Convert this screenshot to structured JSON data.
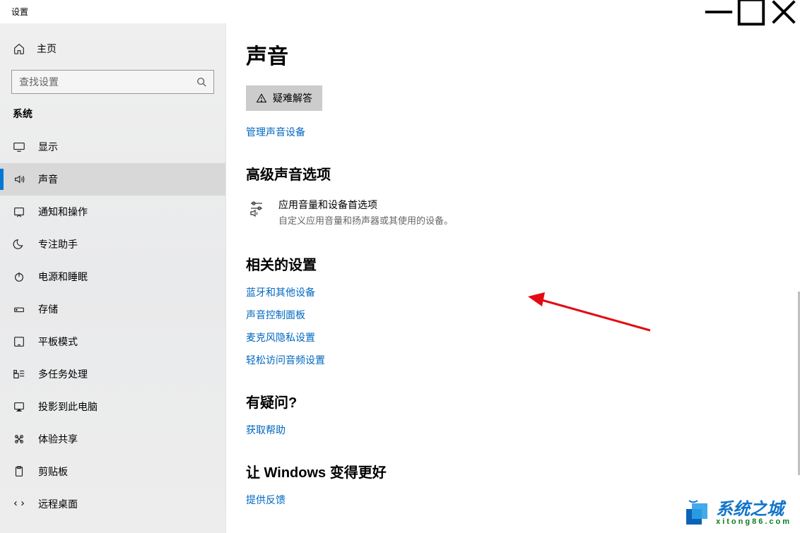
{
  "window": {
    "title": "设置"
  },
  "controls": {
    "min": "–",
    "max": "☐",
    "close": "✕"
  },
  "sidebar": {
    "home": "主页",
    "search_placeholder": "查找设置",
    "category": "系统",
    "items": [
      {
        "label": "显示",
        "icon": "display"
      },
      {
        "label": "声音",
        "icon": "sound",
        "active": true
      },
      {
        "label": "通知和操作",
        "icon": "notify"
      },
      {
        "label": "专注助手",
        "icon": "moon"
      },
      {
        "label": "电源和睡眠",
        "icon": "power"
      },
      {
        "label": "存储",
        "icon": "storage"
      },
      {
        "label": "平板模式",
        "icon": "tablet"
      },
      {
        "label": "多任务处理",
        "icon": "multitask"
      },
      {
        "label": "投影到此电脑",
        "icon": "project"
      },
      {
        "label": "体验共享",
        "icon": "share"
      },
      {
        "label": "剪贴板",
        "icon": "clipboard"
      },
      {
        "label": "远程桌面",
        "icon": "remote"
      }
    ]
  },
  "page": {
    "title": "声音",
    "troubleshoot": "疑难解答",
    "manage_link": "管理声音设备",
    "advanced_head": "高级声音选项",
    "adv_item_title": "应用音量和设备首选项",
    "adv_item_desc": "自定义应用音量和扬声器或其使用的设备。",
    "related_head": "相关的设置",
    "related_links": [
      "蓝牙和其他设备",
      "声音控制面板",
      "麦克风隐私设置",
      "轻松访问音频设置"
    ],
    "faq_head": "有疑问?",
    "faq_link": "获取帮助",
    "better_head": "让 Windows 变得更好",
    "better_link": "提供反馈"
  },
  "watermark": {
    "big": "系统之城",
    "small": "xitong86.com"
  }
}
